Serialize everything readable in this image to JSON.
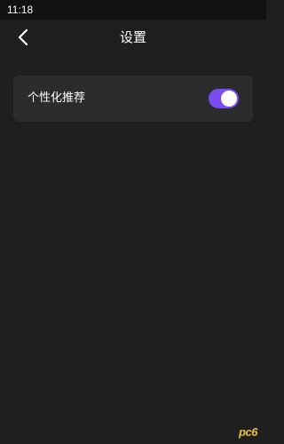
{
  "status_bar": {
    "time": "11:18"
  },
  "header": {
    "back_icon": "chevron-left-icon",
    "title": "设置"
  },
  "settings": {
    "items": [
      {
        "label": "个性化推荐",
        "enabled": true
      }
    ]
  },
  "colors": {
    "background": "#1f1f1f",
    "card": "#2c2c2c",
    "accent": "#7b4cf0"
  },
  "watermark": {
    "text": "pc6"
  }
}
